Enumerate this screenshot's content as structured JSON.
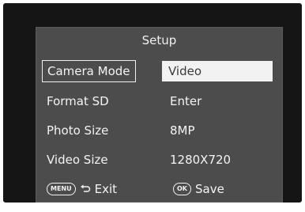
{
  "screen": {
    "title": "Setup"
  },
  "menu": {
    "items": [
      {
        "label": "Camera Mode",
        "value": "Video",
        "selected": true
      },
      {
        "label": "Format SD",
        "value": "Enter",
        "selected": false
      },
      {
        "label": "Photo Size",
        "value": "8MP",
        "selected": false
      },
      {
        "label": "Video Size",
        "value": "1280X720",
        "selected": false
      }
    ]
  },
  "footer": {
    "exit": {
      "key": "MENU",
      "label": "Exit",
      "icon": "return-arrow-icon"
    },
    "save": {
      "key": "OK",
      "label": "Save"
    }
  },
  "colors": {
    "bezel": "#151515",
    "screen_background": "#4c4c4c",
    "text": "#f4f4f4",
    "highlight": "#f2f2f2",
    "highlight_text": "#3a3a3a"
  }
}
